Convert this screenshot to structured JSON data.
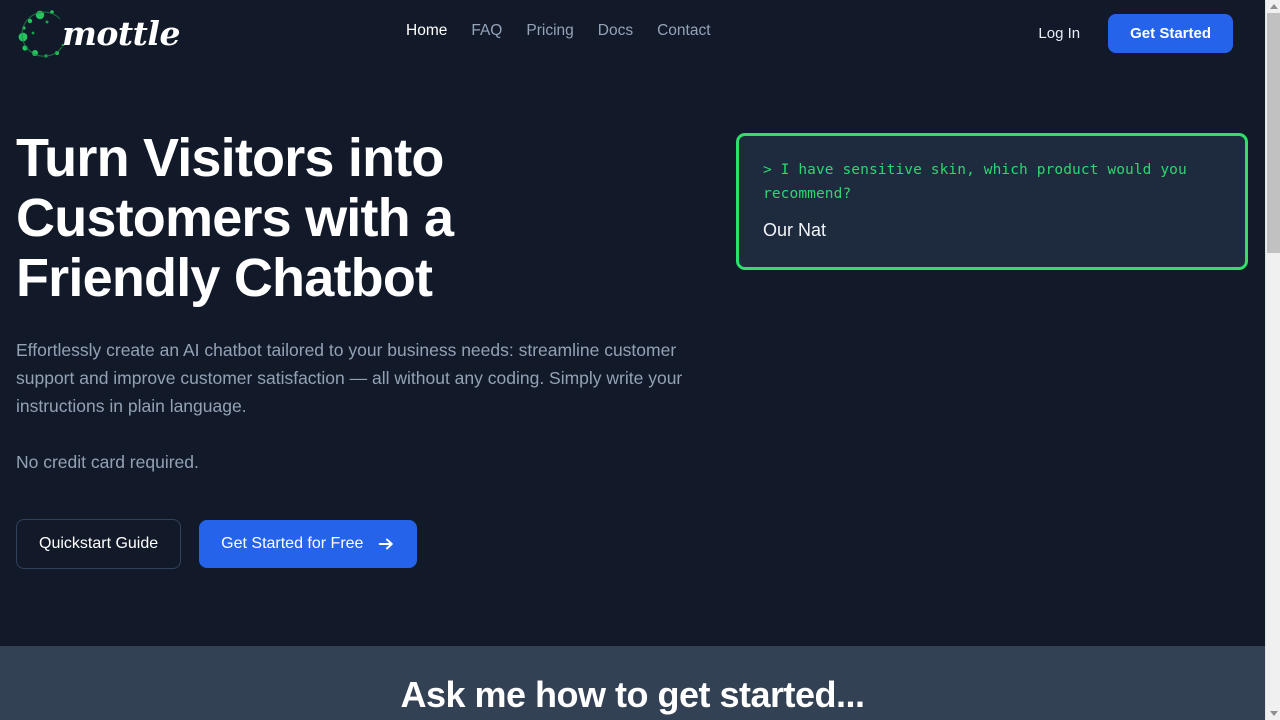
{
  "brand": {
    "logo_text": "mottle",
    "logo_dot_color": "#22c55e",
    "accent_blue": "#2563eb",
    "accent_green": "#2ee06a",
    "background": "#121a2a",
    "band_background": "#334155"
  },
  "header": {
    "nav": [
      {
        "label": "Home",
        "active": true
      },
      {
        "label": "FAQ",
        "active": false
      },
      {
        "label": "Pricing",
        "active": false
      },
      {
        "label": "Docs",
        "active": false
      },
      {
        "label": "Contact",
        "active": false
      }
    ],
    "login_label": "Log In",
    "get_started_label": "Get Started"
  },
  "hero": {
    "headline": "Turn Visitors into Customers with a Friendly Chatbot",
    "subtitle": "Effortlessly create an AI chatbot tailored to your business needs: streamline customer support and improve customer satisfaction — all without any coding. Simply write your instructions in plain language.",
    "no_card": "No credit card required.",
    "secondary_cta": "Quickstart Guide",
    "primary_cta": "Get Started for Free",
    "primary_cta_icon": "arrow-right-icon"
  },
  "chat_demo": {
    "question": "> I have sensitive skin, which product would you recommend?",
    "answer": "Our Nat"
  },
  "band": {
    "title": "Ask me how to get started..."
  },
  "scrollbar": {
    "up_icon": "scroll-up-arrow-icon",
    "down_icon": "scroll-down-arrow-icon"
  }
}
